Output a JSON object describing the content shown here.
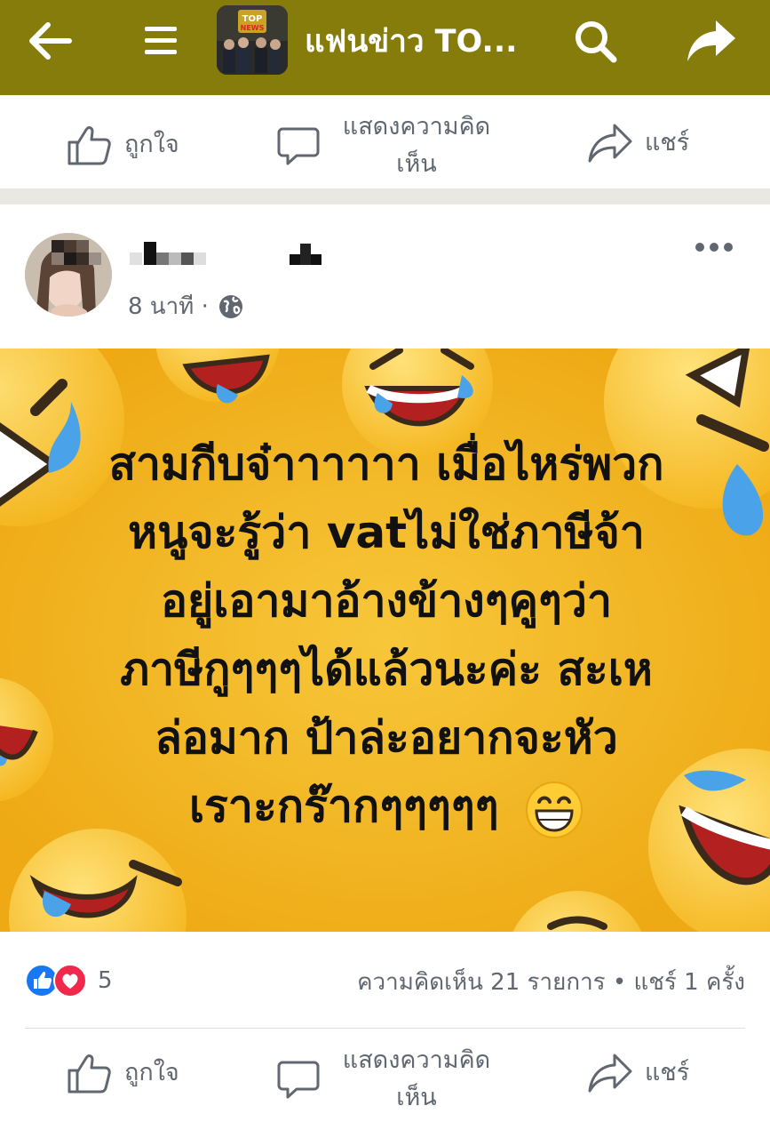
{
  "header": {
    "back_icon": "arrow-left-icon",
    "menu_icon": "hamburger-menu-icon",
    "avatar_logo_text": "TOP NEWS",
    "title": "แฟนข่าว TO...",
    "search_icon": "search-icon",
    "share_icon": "share-arrow-icon",
    "color": "#857c0c"
  },
  "top_actions": {
    "like": "ถูกใจ",
    "comment": "แสดงความคิดเห็น",
    "share": "แชร์"
  },
  "post": {
    "time": "8 นาที ·",
    "privacy_icon": "globe-icon",
    "more_icon": "more-horizontal-icon",
    "lines": [
      "สามกีบจ๋าาาาาา เมื่อไหร่พวก",
      "หนูจะรู้ว่า vatไม่ใช่ภาษีจ้า",
      "อยู่เอามาอ้างข้างๆคูๆว่า",
      "ภาษีกูๆๆๆได้แล้วนะค่ะ สะเห",
      "ล่อมาก ป้าล่ะอยากจะหัว",
      "เราะกร๊ากๆๆๆๆๆ"
    ],
    "emoji": "grinning-face-icon",
    "background_color": "#f3b51f"
  },
  "footer": {
    "reaction_count": "5",
    "stats": "ความคิดเห็น 21 รายการ • แชร์ 1 ครั้ง"
  }
}
